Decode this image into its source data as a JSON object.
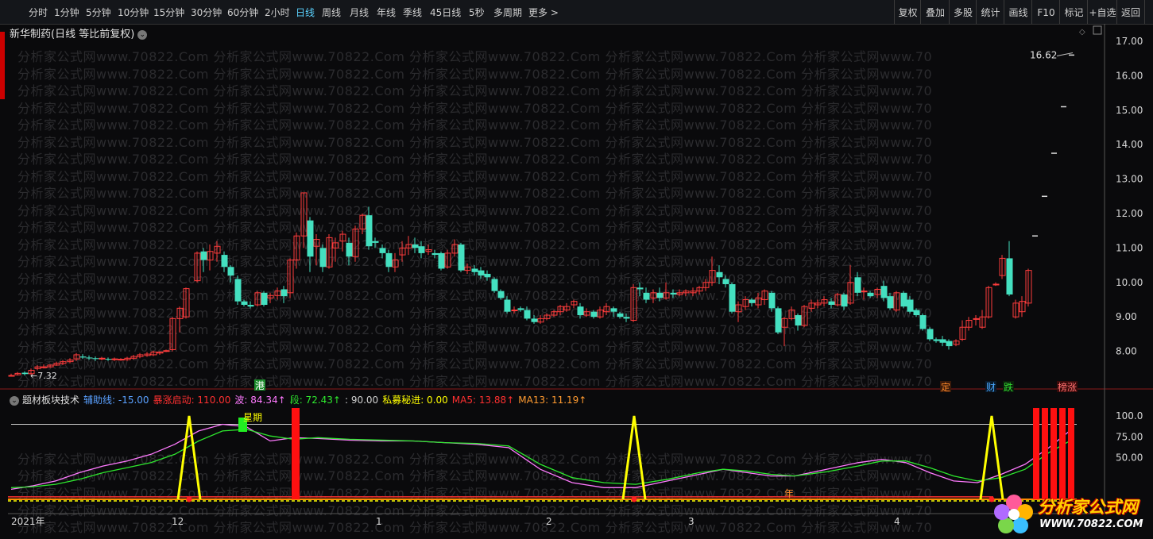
{
  "toolbar": {
    "timeframes": [
      "分时",
      "1分钟",
      "5分钟",
      "10分钟",
      "15分钟",
      "30分钟",
      "60分钟",
      "2小时",
      "日线",
      "周线",
      "月线",
      "年线",
      "季线",
      "45日线",
      "5秒",
      "多周期",
      "更多 >"
    ],
    "active_index": 8,
    "tools": [
      "复权",
      "叠加",
      "多股",
      "统计",
      "画线",
      "F10",
      "标记",
      "+自选",
      "返回"
    ]
  },
  "stock_title": "新华制药(日线 等比前复权)",
  "watermark": "分析家公式网www.70822.Com",
  "price_axis": [
    "17.00",
    "16.00",
    "15.00",
    "14.00",
    "13.00",
    "12.00",
    "11.00",
    "10.00",
    "9.00",
    "8.00"
  ],
  "price_annotations": {
    "high": "16.62",
    "low": "7.32"
  },
  "indicator": {
    "name": "题材板块技术",
    "items": [
      {
        "label": "辅助线: -15.00",
        "color": "#5aa0ff"
      },
      {
        "label": "暴涨启动: 110.00",
        "color": "#ff3030"
      },
      {
        "label": "波: 84.34↑",
        "color": "#ff7aff"
      },
      {
        "label": "段: 72.43↑",
        "color": "#2ee82e"
      },
      {
        "label": ": 90.00",
        "color": "#d0d0d0"
      },
      {
        "label": "私募秘进: 0.00",
        "color": "#ffff00"
      },
      {
        "label": "MA5: 13.88↑",
        "color": "#ff3030"
      },
      {
        "label": "MA13: 11.19↑",
        "color": "#ff9b30"
      }
    ]
  },
  "ind_axis": [
    "100.0",
    "75.00",
    "50.00"
  ],
  "date_axis": [
    "2021年",
    "12",
    "1",
    "2",
    "3",
    "4"
  ],
  "tags": {
    "gang": "港",
    "ding": "定",
    "cai": "财",
    "die": "跌",
    "bang": "榜涨",
    "xingqi": "星期",
    "nian": "年"
  },
  "colors": {
    "up": "#ff3c3c",
    "down": "#44e0c0",
    "bg": "#0a0a0c"
  },
  "logo": {
    "line1": "分析家公式网",
    "line2": "WWW.70822.COM"
  }
}
